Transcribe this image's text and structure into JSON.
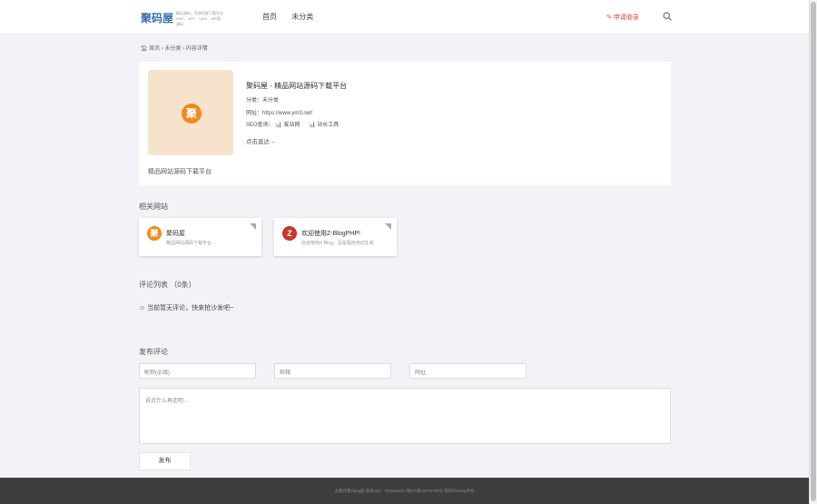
{
  "header": {
    "logo": "聚码屋",
    "tagline": "精品源码，资源资源下载平台 WAP、APP、WEB、AIR等，源码…",
    "nav": [
      "首页",
      "未分类"
    ],
    "apply": "✎ 申请收录",
    "search_icon": "search-icon"
  },
  "breadcrumb": "🏠 首页  ›  未分类  ›  内容详情",
  "site": {
    "badge": "聚",
    "title": "聚码屋 - 精品网站源码下载平台",
    "category": "分类：未分类",
    "url": "网址：https://www.ym3.net/",
    "seo_label": "SEO查询：",
    "seo_links": [
      "📊 爱站网",
      "📊 站长工具"
    ],
    "visit": "点击直达→",
    "description": "精品网站源码下载平台"
  },
  "related": {
    "title": "相关网站",
    "items": [
      {
        "name": "聚码屋",
        "desc": "精品网站源码下载平台...",
        "icon": "聚",
        "color": "#f08a1c"
      },
      {
        "name": "欢迎使用Z-BlogPHP!",
        "desc": "欢迎使用Z-Blog，这是程序自动生成",
        "icon": "Z",
        "color": "#c8362c"
      }
    ]
  },
  "comments": {
    "title": "评论列表  （0条）",
    "empty": "☺ 当前暂无评论，快来抢沙发吧~"
  },
  "form": {
    "title": "发布评论",
    "name_placeholder": "昵称(必填)",
    "email_placeholder": "邮箱",
    "url_placeholder": "网址",
    "content_placeholder": "说点什么再走吧...",
    "submit": "发布"
  },
  "footer": "主题作者zblog屋   联系QQ：792063026   湘ICP备19375780号   版权归zblog所有"
}
